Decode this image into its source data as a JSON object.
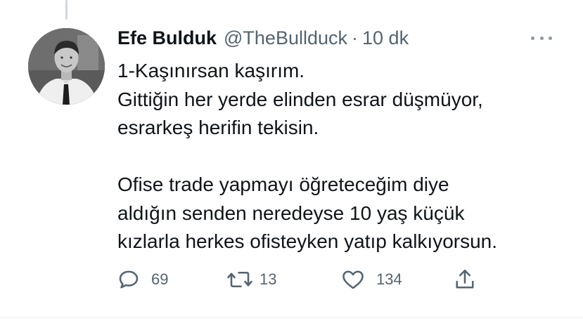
{
  "tweet": {
    "author_name": "Efe Bulduk",
    "author_handle": "@TheBullduck",
    "separator": "·",
    "time_ago": "10 dk",
    "avatar_icon": "profile-photo",
    "more_icon": "more-options-icon",
    "text_lines": [
      "1-Kaşınırsan kaşırım.",
      "Gittiğin her yerde elinden esrar düşmüyor,",
      "esrarkeş herifin tekisin.",
      "",
      "Ofise trade yapmayı öğreteceğim diye",
      "aldığın senden neredeyse 10 yaş küçük",
      "kızlarla herkes ofisteyken yatıp kalkıyorsun."
    ]
  },
  "actions": {
    "reply_count": "69",
    "retweet_count": "13",
    "like_count": "134",
    "icons": [
      "reply-icon",
      "retweet-icon",
      "like-icon",
      "share-icon"
    ]
  },
  "colors": {
    "text": "#0f1419",
    "secondary": "#536471",
    "divider": "#e6ecf0"
  }
}
